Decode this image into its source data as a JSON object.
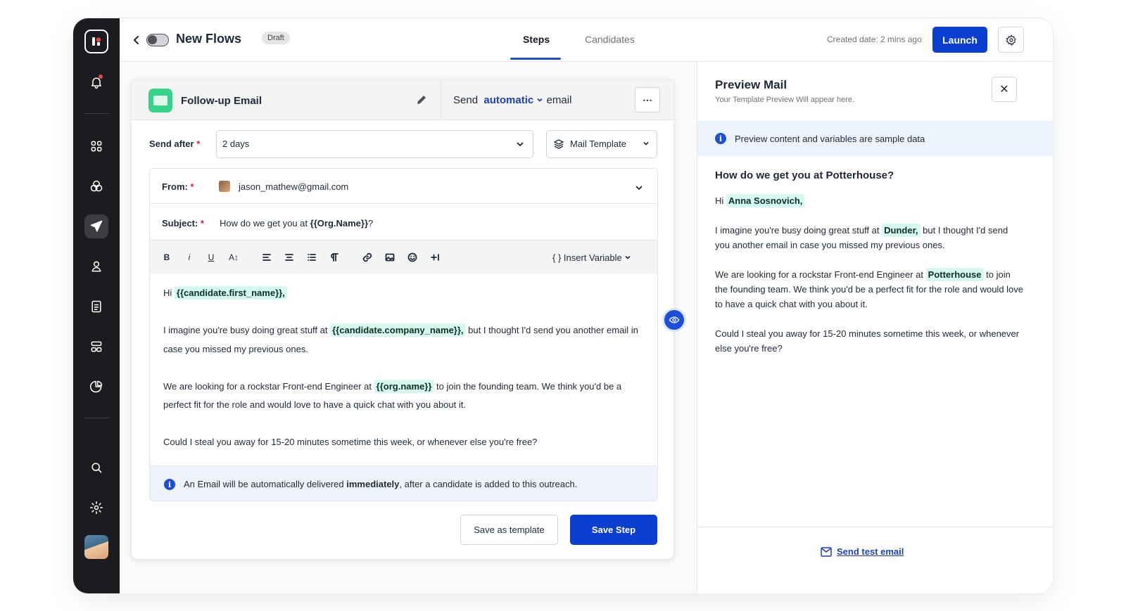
{
  "topbar": {
    "flow_title": "New Flows",
    "status_badge": "Draft",
    "tabs": [
      {
        "label": "Steps",
        "active": true
      },
      {
        "label": "Candidates",
        "active": false
      }
    ],
    "created": "Created date: 2 mins ago",
    "launch_label": "Launch"
  },
  "step": {
    "title": "Follow-up Email",
    "send_prefix": "Send",
    "send_mode": "automatic",
    "send_suffix": "email",
    "more_label": "⋯",
    "send_after_label": "Send after",
    "send_after_value": "2 days",
    "mail_template_label": "Mail Template",
    "from_label": "From:",
    "from_value": "jason_mathew@gmail.com",
    "subject_label": "Subject:",
    "subject_prefix": "How do we get you at",
    "subject_var": "{{Org.Name}}",
    "subject_suffix": "?",
    "toolbar": {
      "bold": "B",
      "italic": "i",
      "underline": "U",
      "size": "A↕",
      "insert_variable": "{ }  Insert Variable"
    },
    "body": {
      "p1_pre": "Hi",
      "p1_var": "{{candidate.first_name}},",
      "p2_pre": "I imagine you're busy doing great stuff at",
      "p2_var": "{{candidate.company_name}},",
      "p2_post": "but I thought I'd send you another email in case you missed my previous ones.",
      "p3_pre": "We are looking for a rockstar Front-end Engineer at",
      "p3_var": "{{org.name}}",
      "p3_post": "to join the founding team. We think you'd be a perfect fit for the role and would love to have a quick chat with you about it.",
      "p4": "Could I steal you away for 15-20 minutes sometime this week, or whenever else you're free?"
    },
    "notice_pre": "An Email will be automatically delivered",
    "notice_bold": "immediately",
    "notice_post": ", after a candidate is added to this outreach.",
    "save_template_label": "Save as template",
    "save_step_label": "Save Step"
  },
  "preview": {
    "title": "Preview Mail",
    "subtitle": "Your Template Preview Will appear here.",
    "note": "Preview content and variables are sample data",
    "subject": "How do we get you at Potterhouse?",
    "p1_pre": "Hi",
    "p1_var": "Anna Sosnovich,",
    "p2_pre": "I imagine you're busy doing great stuff at",
    "p2_var": "Dunder,",
    "p2_post": "but I thought I'd send you another email in case you missed my previous ones.",
    "p3_pre": "We are looking for a rockstar Front-end Engineer at",
    "p3_var": "Potterhouse",
    "p3_post": "to join the founding team. We think you'd be a perfect fit for the role and would love to have a quick chat with you about it.",
    "p4": "Could I steal you away for 15-20 minutes sometime this week, or whenever else you're free?",
    "send_test_label": "Send test email"
  },
  "colors": {
    "primary": "#0b3fd1",
    "variable_bg": "#d5f8ef",
    "rail_bg": "#1b1c1f"
  }
}
